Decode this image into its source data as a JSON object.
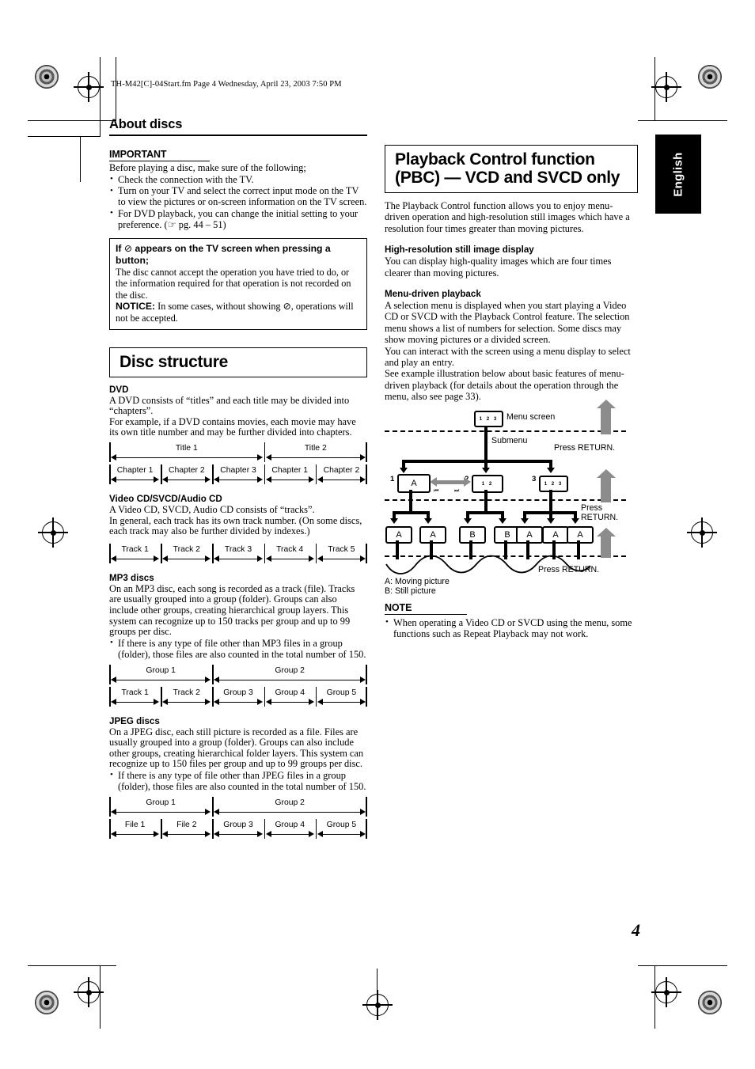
{
  "file_header": "TH-M42[C]-04Start.fm  Page 4  Wednesday, April 23, 2003  7:50 PM",
  "page_number": "4",
  "side_tab": "English",
  "left_column": {
    "section_title": "About discs",
    "important": {
      "heading": "IMPORTANT",
      "intro": "Before playing a disc, make sure of the following;",
      "bullets": [
        "Check the connection with the TV.",
        "Turn on your TV and select the correct input mode on the TV to view the pictures or on-screen information on the TV screen.",
        "For DVD playback, you can change the initial setting to your preference. (☞ pg. 44 – 51)"
      ]
    },
    "prohibit_box": {
      "title_pre": "If ",
      "title_icon": "⊘",
      "title_post": " appears on the TV screen when pressing a button;",
      "body": "The disc cannot accept the operation you have tried to do, or the information required for that operation is not recorded on the disc.",
      "notice_label": "NOTICE:",
      "notice_pre": " In some cases, without showing ",
      "notice_icon": "⊘",
      "notice_post": ", operations will not be accepted."
    },
    "disc_structure": {
      "heading": "Disc structure",
      "dvd": {
        "subhead": "DVD",
        "p1": "A DVD consists of “titles” and each title may be divided into “chapters”.",
        "p2": "For example, if a DVD contains movies, each movie may have its own title number and may be further divided into chapters.",
        "top_row": [
          {
            "label": "Title 1",
            "span": 3
          },
          {
            "label": "Title 2",
            "span": 2
          }
        ],
        "bottom_row": [
          "Chapter 1",
          "Chapter 2",
          "Chapter 3",
          "Chapter 1",
          "Chapter 2"
        ]
      },
      "cd": {
        "subhead": "Video CD/SVCD/Audio CD",
        "p1": "A Video CD, SVCD, Audio CD consists of “tracks”.",
        "p2": "In general, each track has its own track number. (On some discs, each track may also be further divided by indexes.)",
        "row": [
          "Track 1",
          "Track 2",
          "Track 3",
          "Track 4",
          "Track 5"
        ]
      },
      "mp3": {
        "subhead": "MP3 discs",
        "p1": "On an MP3 disc, each song is recorded as a track (file). Tracks are usually grouped into a group (folder). Groups can also include other groups, creating hierarchical group layers. This system can recognize up to 150 tracks per group and up to 99 groups per disc.",
        "bullet": "If there is any type of file other than MP3 files in a group (folder), those files are also counted in the total number of 150.",
        "top_row": [
          {
            "label": "Group 1",
            "span": 2
          },
          {
            "label": "Group 2",
            "span": 3
          }
        ],
        "bottom_row": [
          "Track 1",
          "Track 2",
          "Group 3",
          "Group 4",
          "Group 5"
        ]
      },
      "jpeg": {
        "subhead": "JPEG discs",
        "p1": "On a JPEG disc, each still picture is recorded as a file. Files are usually grouped into a group (folder). Groups can also include other groups, creating hierarchical folder layers. This system can recognize up to 150 files per group and up to 99 groups per disc.",
        "bullet": "If there is any type of file other than JPEG files in a group (folder), those files are also counted in the total number of 150.",
        "top_row": [
          {
            "label": "Group 1",
            "span": 2
          },
          {
            "label": "Group 2",
            "span": 3
          }
        ],
        "bottom_row": [
          "File 1",
          "File 2",
          "Group 3",
          "Group 4",
          "Group 5"
        ]
      }
    }
  },
  "right_column": {
    "heading": "Playback Control function (PBC) — VCD and SVCD only",
    "intro": "The Playback Control function allows you to enjoy menu-driven operation and high-resolution still images which have a resolution four times greater than moving pictures.",
    "hires": {
      "subhead": "High-resolution still image display",
      "body": "You can display high-quality images which are four times clearer than moving pictures."
    },
    "menu_driven": {
      "subhead": "Menu-driven playback",
      "p1": "A selection menu is displayed when you start playing a Video CD or SVCD with the Playback Control feature. The selection menu shows a list of numbers for selection. Some discs may show moving pictures or a divided screen.",
      "p2": "You can interact with the screen using a menu display to select and play an entry.",
      "p3": "See example illustration below about basic features of menu-driven playback (for details about the operation through the menu, also see page 33)."
    },
    "diagram": {
      "menu_screen_label": "Menu screen",
      "menu_screen_box": "1 2 3",
      "submenu_label": "Submenu",
      "submenu_items": [
        {
          "num": "1",
          "box": "A"
        },
        {
          "num": "2",
          "box": "1   2"
        },
        {
          "num": "3",
          "box": "1 2 3"
        }
      ],
      "skip_back": "⏮",
      "skip_fwd": "⏭",
      "leaf_row": [
        "A",
        "A",
        "B",
        "B",
        "A",
        "A",
        "A"
      ],
      "return_labels": [
        "Press RETURN.",
        "Press RETURN.",
        "Press RETURN."
      ],
      "legend": [
        "A: Moving picture",
        "B: Still picture"
      ]
    },
    "note": {
      "heading": "NOTE",
      "bullet": "When operating a Video CD or SVCD using the menu, some functions such as Repeat Playback may not work."
    }
  }
}
